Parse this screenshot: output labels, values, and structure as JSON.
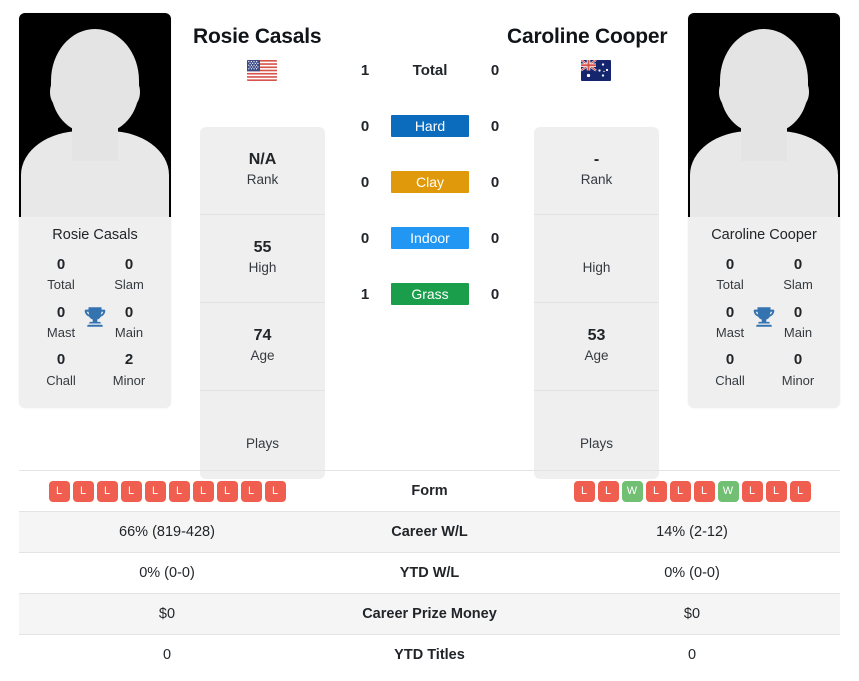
{
  "players": {
    "left": {
      "name": "Rosie Casals",
      "flag": "us-flag-icon",
      "country": "United States",
      "card_name": "Rosie Casals",
      "titles": [
        {
          "value": "0",
          "label": "Total"
        },
        {
          "value": "0",
          "label": "Slam"
        },
        {
          "value": "0",
          "label": "Mast"
        },
        {
          "value": "0",
          "label": "Main"
        },
        {
          "value": "0",
          "label": "Chall"
        },
        {
          "value": "2",
          "label": "Minor"
        }
      ],
      "info": [
        {
          "value": "N/A",
          "label": "Rank"
        },
        {
          "value": "55",
          "label": "High"
        },
        {
          "value": "74",
          "label": "Age"
        },
        {
          "value": "",
          "label": "Plays"
        }
      ]
    },
    "right": {
      "name": "Caroline Cooper",
      "flag": "au-flag-icon",
      "country": "Australia",
      "card_name": "Caroline Cooper",
      "titles": [
        {
          "value": "0",
          "label": "Total"
        },
        {
          "value": "0",
          "label": "Slam"
        },
        {
          "value": "0",
          "label": "Mast"
        },
        {
          "value": "0",
          "label": "Main"
        },
        {
          "value": "0",
          "label": "Chall"
        },
        {
          "value": "0",
          "label": "Minor"
        }
      ],
      "info": [
        {
          "value": "-",
          "label": "Rank"
        },
        {
          "value": "",
          "label": "High"
        },
        {
          "value": "53",
          "label": "Age"
        },
        {
          "value": "",
          "label": "Plays"
        }
      ]
    }
  },
  "h2h": {
    "total": {
      "label": "Total",
      "left": "1",
      "right": "0"
    },
    "surfaces": [
      {
        "label": "Hard",
        "left": "0",
        "right": "0",
        "color": "#0b6bbd"
      },
      {
        "label": "Clay",
        "left": "0",
        "right": "0",
        "color": "#e0990b"
      },
      {
        "label": "Indoor",
        "left": "0",
        "right": "0",
        "color": "#2196f3"
      },
      {
        "label": "Grass",
        "left": "1",
        "right": "0",
        "color": "#1a9e4b"
      }
    ]
  },
  "comparison": {
    "rows": [
      {
        "label": "Form",
        "type": "form",
        "left": [
          "L",
          "L",
          "L",
          "L",
          "L",
          "L",
          "L",
          "L",
          "L",
          "L"
        ],
        "right": [
          "L",
          "L",
          "W",
          "L",
          "L",
          "L",
          "W",
          "L",
          "L",
          "L"
        ]
      },
      {
        "label": "Career W/L",
        "type": "text",
        "left": "66% (819-428)",
        "right": "14% (2-12)"
      },
      {
        "label": "YTD W/L",
        "type": "text",
        "left": "0% (0-0)",
        "right": "0% (0-0)"
      },
      {
        "label": "Career Prize Money",
        "type": "text",
        "left": "$0",
        "right": "$0"
      },
      {
        "label": "YTD Titles",
        "type": "text",
        "left": "0",
        "right": "0"
      }
    ]
  },
  "colors": {
    "form_loss": "#ef5e4e",
    "form_win": "#71bf73",
    "trophy": "#3572b0",
    "panel_bg": "#efefef",
    "row_alt_bg": "#f5f5f5"
  }
}
